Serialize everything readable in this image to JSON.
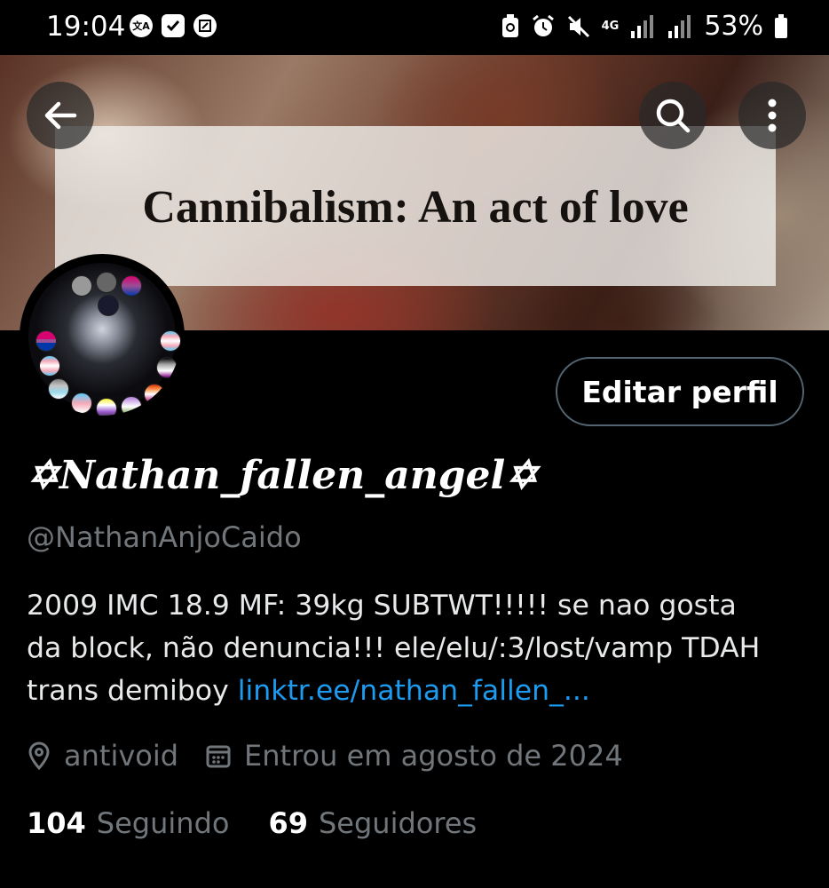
{
  "status_bar": {
    "time": "19:04",
    "translate_icon_text": "文A",
    "network": "4G",
    "battery": "53%"
  },
  "banner": {
    "caption": "Cannibalism: An act of love"
  },
  "actions": {
    "back": "back-arrow-icon",
    "search": "search-icon",
    "more": "more-vertical-icon"
  },
  "profile": {
    "edit_button": "Editar perfil",
    "display_name": "✡Nathan_fallen_angel✡",
    "handle": "@NathanAnjoCaido",
    "bio_line1": "2009 IMC 18.9 MF: 39kg SUBTWT!!!!! se nao gosta",
    "bio_line2": "da block, não denuncia!!! ele/elu/:3/lost/vamp TDAH",
    "bio_line3": "trans demiboy ",
    "bio_link": "linktr.ee/nathan_fallen_...",
    "location": "antivoid",
    "joined": "Entrou em agosto de 2024",
    "following_count": "104",
    "following_label": "Seguindo",
    "followers_count": "69",
    "followers_label": "Seguidores"
  },
  "colors": {
    "background": "#000000",
    "text": "#e7e9ea",
    "muted": "#71767b",
    "link": "#1d9bf0",
    "button_border": "#536471"
  }
}
